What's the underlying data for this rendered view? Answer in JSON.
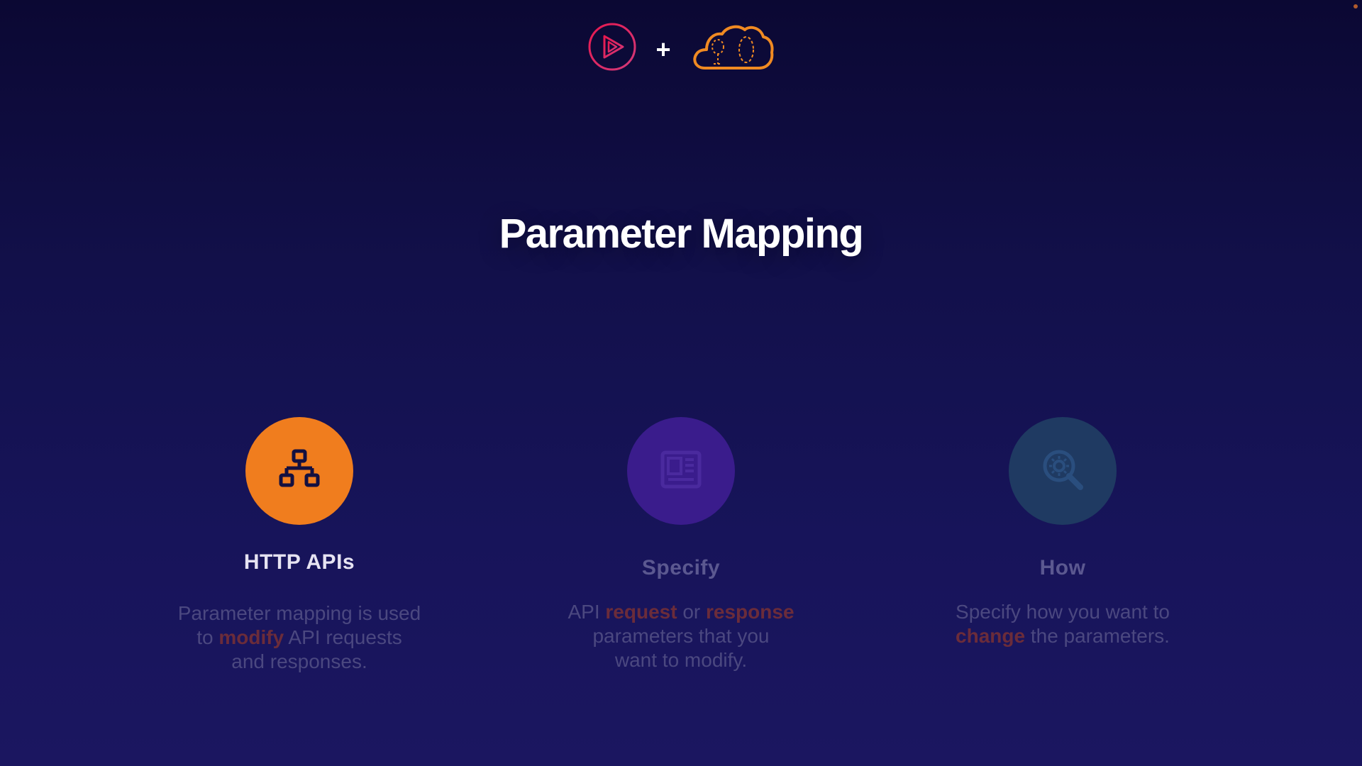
{
  "logo": {
    "plus": "+"
  },
  "title": "Parameter Mapping",
  "cards": [
    {
      "title": "HTTP APIs",
      "icon": "hierarchy-icon",
      "color": "#f07d1e",
      "desc": {
        "line1": "Parameter mapping is used",
        "line2_pre": "to ",
        "line2_hl": "modify",
        "line2_post": " API requests",
        "line3": "and responses."
      }
    },
    {
      "title": "Specify",
      "icon": "document-icon",
      "color": "#3a1c8c",
      "desc": {
        "line1_pre": "API ",
        "line1_hl1": "request",
        "line1_mid": " or ",
        "line1_hl2": "response",
        "line2": "parameters that you",
        "line3": "want to  modify."
      }
    },
    {
      "title": "How",
      "icon": "search-gear-icon",
      "color": "#1f3a62",
      "desc": {
        "line1": "Specify how you want to",
        "line2_hl": "change",
        "line2_post": " the parameters."
      }
    }
  ]
}
